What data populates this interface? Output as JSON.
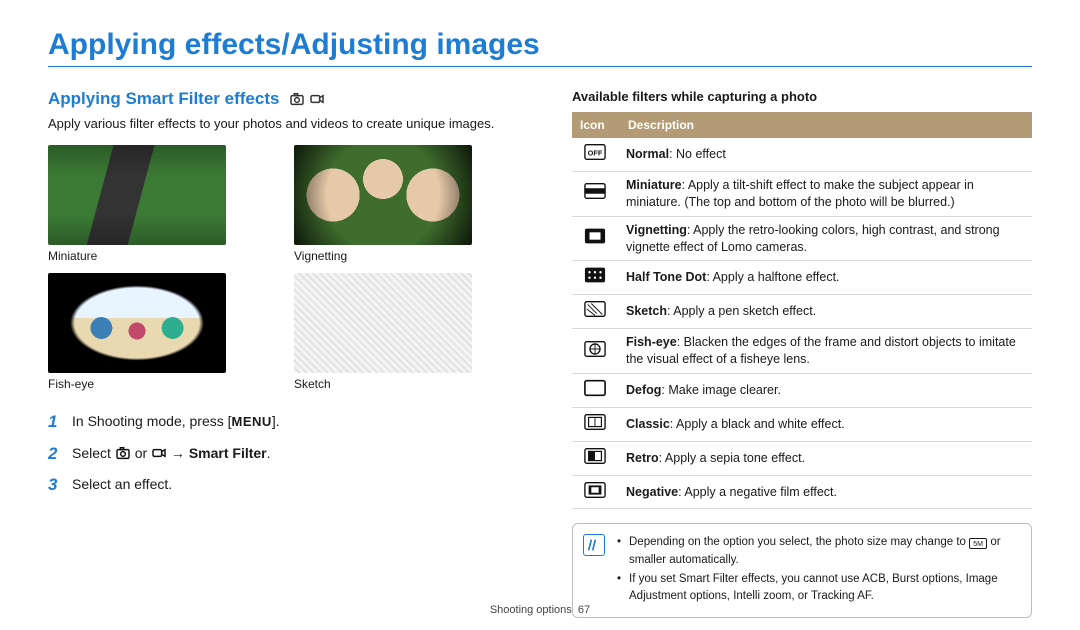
{
  "page": {
    "title": "Applying effects/Adjusting images",
    "footer_section": "Shooting options",
    "footer_page": "67"
  },
  "section": {
    "title": "Applying Smart Filter effects",
    "subtitle": "Apply various filter effects to your photos and videos to create unique images."
  },
  "thumbnails": [
    {
      "name": "miniature",
      "label": "Miniature"
    },
    {
      "name": "vignetting",
      "label": "Vignetting"
    },
    {
      "name": "fisheye",
      "label": "Fish-eye"
    },
    {
      "name": "sketch",
      "label": "Sketch"
    }
  ],
  "steps": {
    "one_text_a": "In Shooting mode, press [",
    "one_menu": "MENU",
    "one_text_b": "].",
    "two_text_a": "Select ",
    "two_text_b": " or ",
    "two_arrow": " → ",
    "two_bold": "Smart Filter",
    "two_text_c": ".",
    "three_text": "Select an effect."
  },
  "filters_table": {
    "title": "Available filters while capturing a photo",
    "header_icon": "Icon",
    "header_desc": "Description",
    "rows": [
      {
        "bold": "Normal",
        "text": ": No effect"
      },
      {
        "bold": "Miniature",
        "text": ": Apply a tilt-shift effect to make the subject appear in miniature. (The top and bottom of the photo will be blurred.)"
      },
      {
        "bold": "Vignetting",
        "text": ": Apply the retro-looking colors, high contrast, and strong vignette effect of Lomo cameras."
      },
      {
        "bold": "Half Tone Dot",
        "text": ": Apply a halftone effect."
      },
      {
        "bold": "Sketch",
        "text": ": Apply a pen sketch effect."
      },
      {
        "bold": "Fish-eye",
        "text": ": Blacken the edges of the frame and distort objects to imitate the visual effect of a fisheye lens."
      },
      {
        "bold": "Defog",
        "text": ": Make image clearer."
      },
      {
        "bold": "Classic",
        "text": ": Apply a black and white effect."
      },
      {
        "bold": "Retro",
        "text": ": Apply a sepia tone effect."
      },
      {
        "bold": "Negative",
        "text": ": Apply a negative film effect."
      }
    ]
  },
  "notes": {
    "line1_a": "Depending on the option you select, the photo size may change to ",
    "line1_icon": "5M",
    "line1_b": " or smaller automatically.",
    "line2": "If you set Smart Filter effects, you cannot use ACB, Burst options, Image Adjustment options, Intelli zoom, or Tracking AF."
  }
}
